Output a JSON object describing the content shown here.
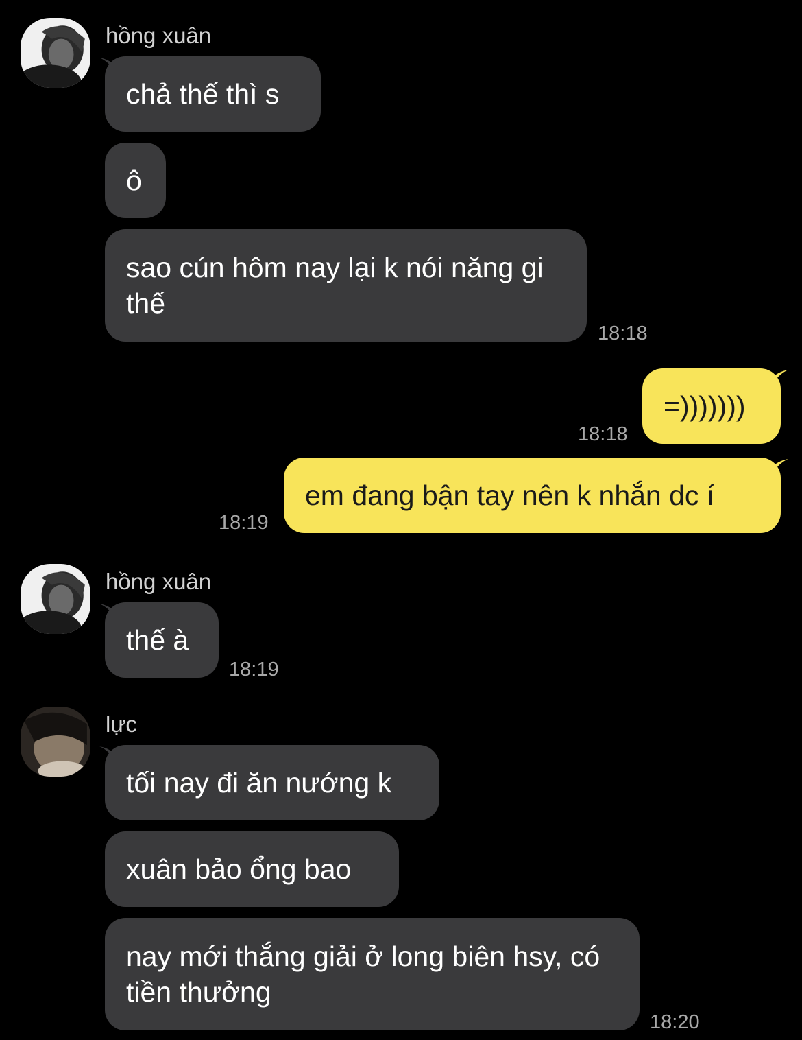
{
  "theme": {
    "background": "#000000",
    "incoming_bubble": "#3a3a3c",
    "outgoing_bubble": "#f8e45a",
    "timestamp_color": "#a8a8a8"
  },
  "groups": [
    {
      "sender": "hồng xuân",
      "avatar_icon": "profile-photo-icon",
      "messages": [
        "chả thế thì s",
        "ô",
        "sao cún hôm nay lại k nói năng gi thế"
      ],
      "time": "18:18"
    },
    {
      "sender": "me",
      "messages": [
        {
          "text": "=)))))))",
          "time": "18:18"
        },
        {
          "text": "em đang bận tay nên k nhắn dc í",
          "time": "18:19"
        }
      ]
    },
    {
      "sender": "hồng xuân",
      "avatar_icon": "profile-photo-icon",
      "messages": [
        "thế à"
      ],
      "time": "18:19"
    },
    {
      "sender": "lực",
      "avatar_icon": "profile-photo-icon",
      "messages": [
        "tối nay đi ăn nướng k",
        "xuân bảo ổng bao",
        "nay mới thắng giải ở long biên hsy, có tiền thưởng"
      ],
      "time": "18:20"
    }
  ]
}
